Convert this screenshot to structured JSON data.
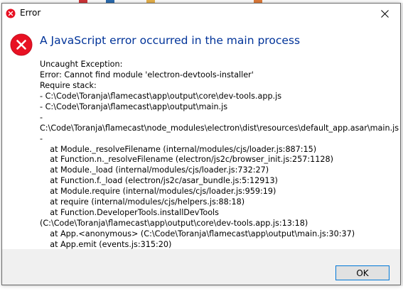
{
  "dialog": {
    "title": "Error",
    "heading": "A JavaScript error occurred in the main process",
    "ok_label": "OK"
  },
  "message_lines": [
    "Uncaught Exception:",
    "Error: Cannot find module 'electron-devtools-installer'",
    "Require stack:",
    "- C:\\Code\\Toranja\\flamecast\\app\\output\\core\\dev-tools.app.js",
    "- C:\\Code\\Toranja\\flamecast\\app\\output\\main.js",
    "-",
    "C:\\Code\\Toranja\\flamecast\\node_modules\\electron\\dist\\resources\\default_app.asar\\main.js",
    "-",
    "    at Module._resolveFilename (internal/modules/cjs/loader.js:887:15)",
    "    at Function.n._resolveFilename (electron/js2c/browser_init.js:257:1128)",
    "    at Module._load (internal/modules/cjs/loader.js:732:27)",
    "    at Function.f._load (electron/js2c/asar_bundle.js:5:12913)",
    "    at Module.require (internal/modules/cjs/loader.js:959:19)",
    "    at require (internal/modules/cjs/helpers.js:88:18)",
    "    at Function.DeveloperTools.installDevTools",
    "(C:\\Code\\Toranja\\flamecast\\app\\output\\core\\dev-tools.app.js:13:18)",
    "    at App.<anonymous> (C:\\Code\\Toranja\\flamecast\\app\\output\\main.js:30:37)",
    "    at App.emit (events.js:315:20)"
  ],
  "colors": {
    "heading": "#003399",
    "error_icon": "#e81123",
    "button_border": "#0078d7"
  },
  "icons": {
    "title": "error-icon",
    "main": "error-icon",
    "close": "close-icon"
  }
}
